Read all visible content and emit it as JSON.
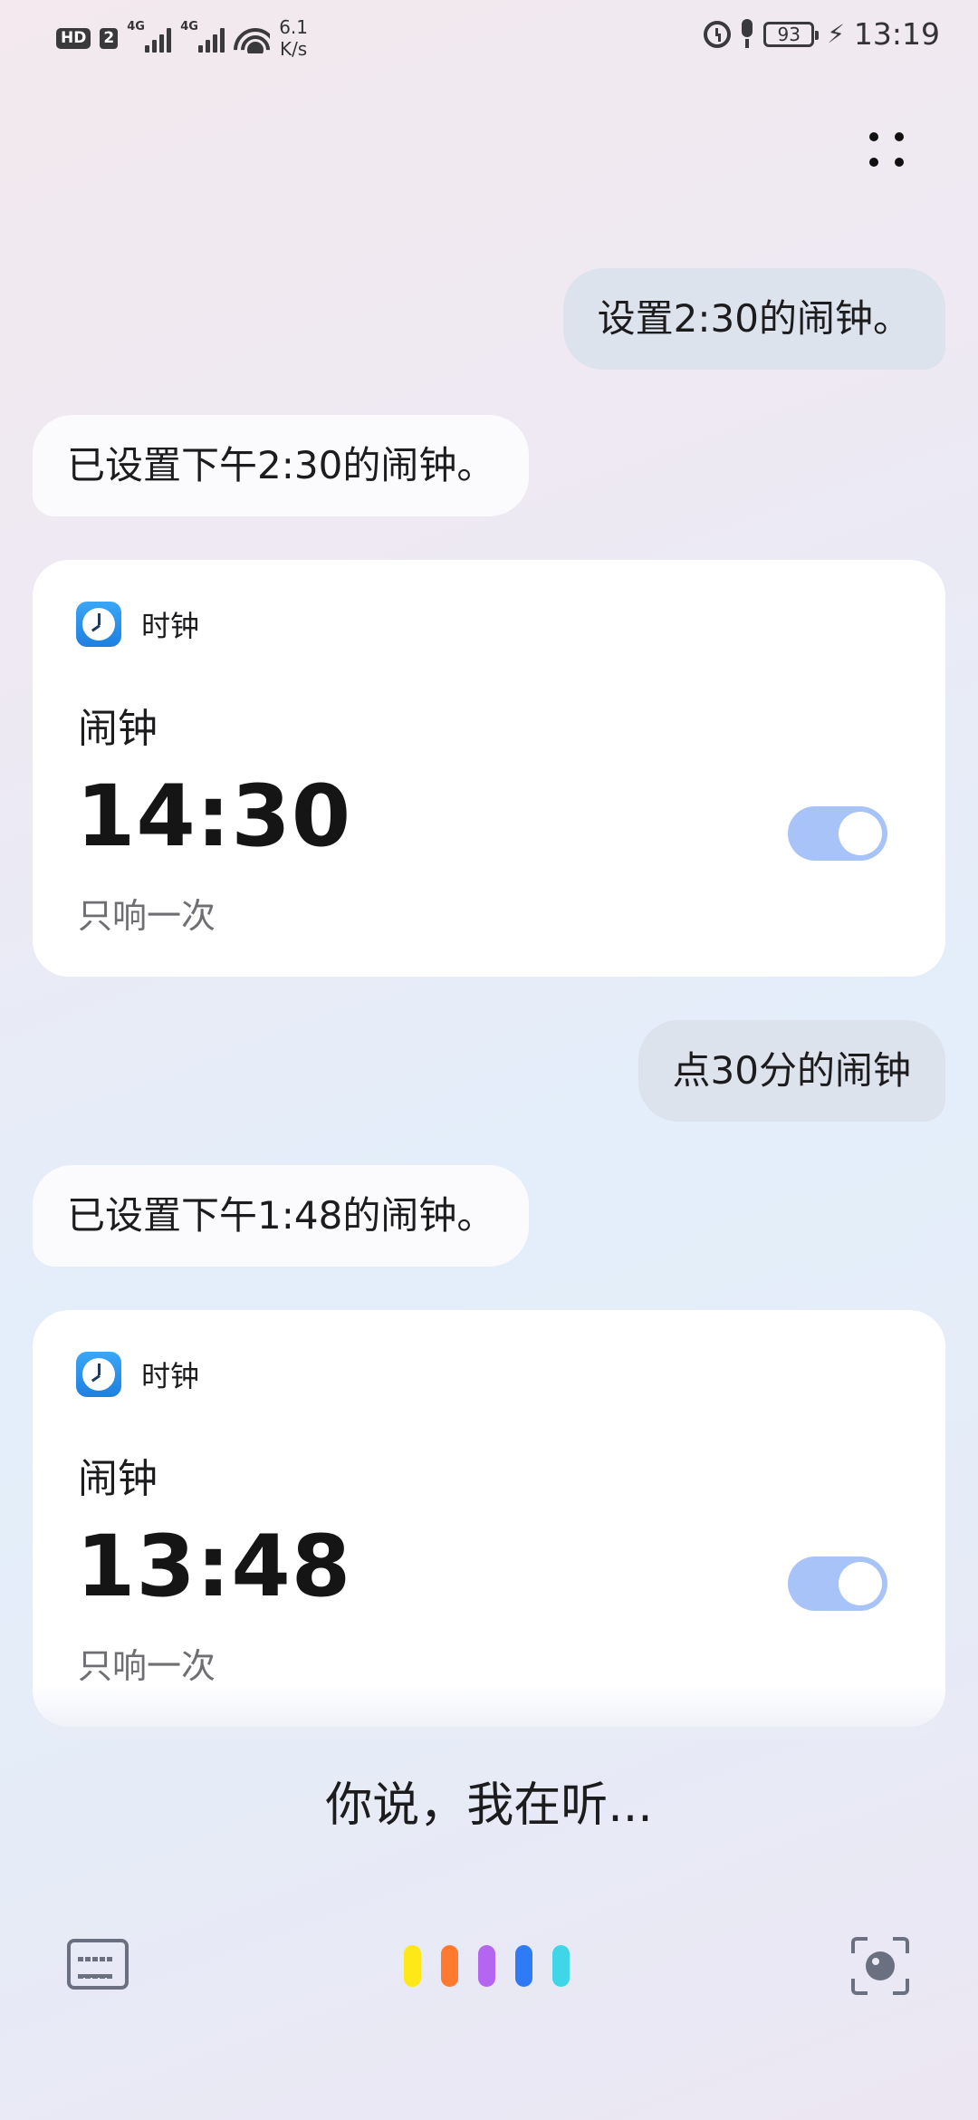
{
  "status_bar": {
    "hd": "HD",
    "sim": "2",
    "net1": "4G",
    "net2": "4G",
    "speed_value": "6.1",
    "speed_unit": "K/s",
    "battery": "93",
    "time": "13:19"
  },
  "conversation": [
    {
      "role": "user",
      "text": "设置2:30的闹钟。"
    },
    {
      "role": "assistant",
      "text": "已设置下午2:30的闹钟。"
    },
    {
      "role": "user",
      "text": "点30分的闹钟"
    },
    {
      "role": "assistant",
      "text": "已设置下午1:48的闹钟。"
    }
  ],
  "cards": [
    {
      "app_name": "时钟",
      "title": "闹钟",
      "time": "14:30",
      "repeat": "只响一次",
      "enabled": true
    },
    {
      "app_name": "时钟",
      "title": "闹钟",
      "time": "13:48",
      "repeat": "只响一次",
      "enabled": true
    }
  ],
  "listening_prompt": "你说，我在听...",
  "colors": {
    "toggle_on": "#a7c3f8",
    "wave": [
      "#ffe817",
      "#ff7a2e",
      "#b466f0",
      "#2f7bf5",
      "#3fd6e8"
    ]
  },
  "icons": {
    "more": "more-dots-icon",
    "keyboard": "keyboard-icon",
    "scan": "scan-camera-icon",
    "app": "clock-app-icon"
  }
}
